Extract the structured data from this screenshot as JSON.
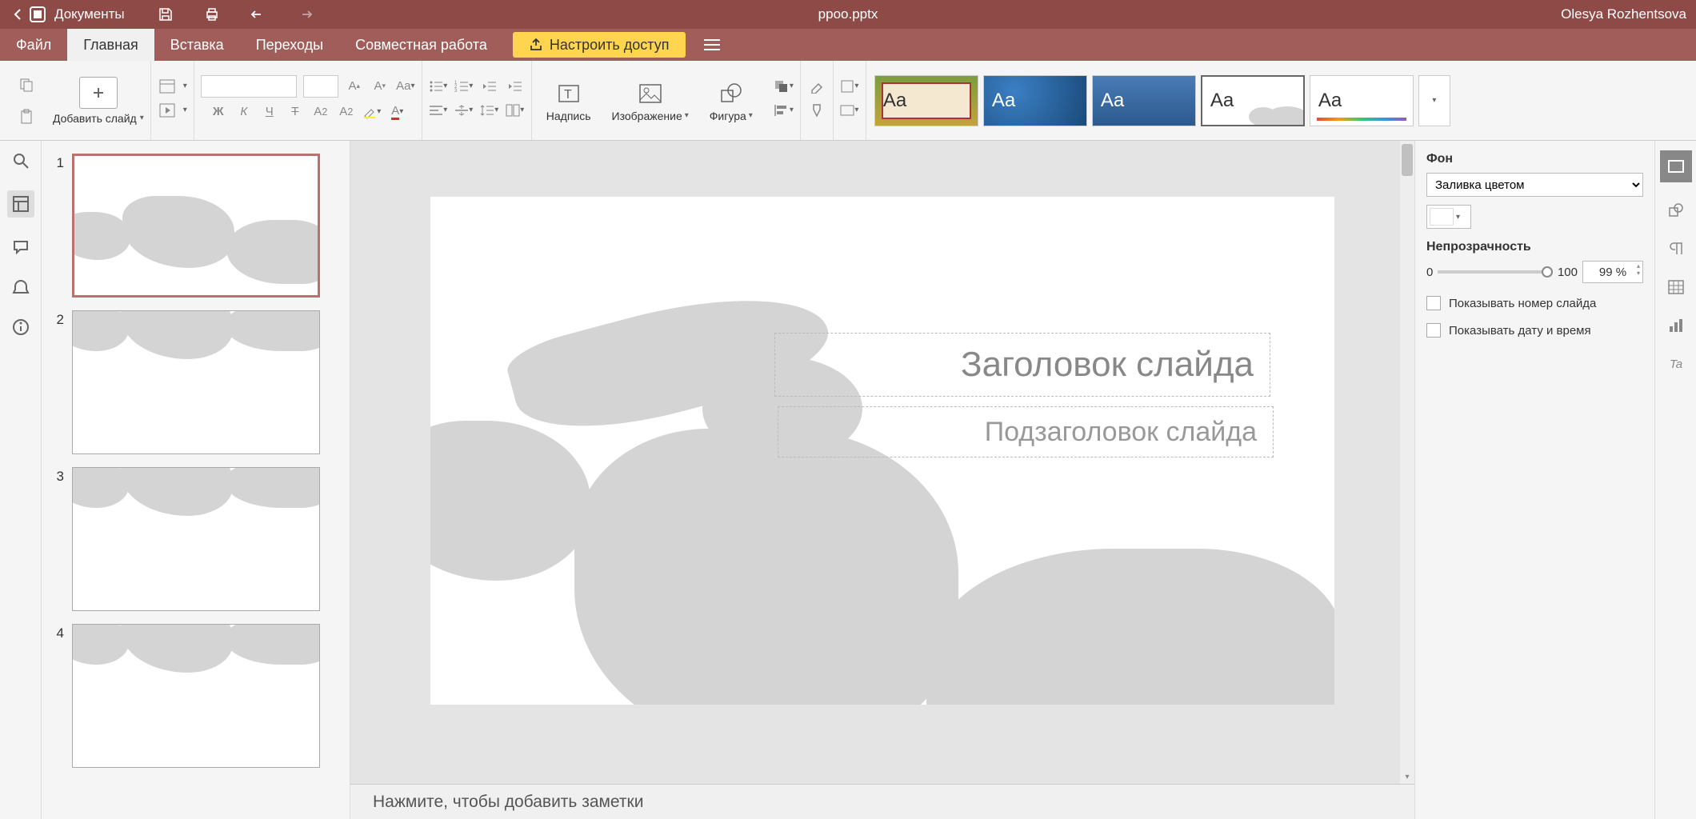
{
  "titlebar": {
    "app_label": "Документы",
    "file_name": "ppoo.pptx",
    "user_name": "Olesya Rozhentsova"
  },
  "menu": {
    "file": "Файл",
    "home": "Главная",
    "insert": "Вставка",
    "transitions": "Переходы",
    "collab": "Совместная работа",
    "share": "Настроить доступ"
  },
  "toolbar": {
    "add_slide": "Добавить слайд",
    "text_box": "Надпись",
    "image": "Изображение",
    "shape": "Фигура"
  },
  "slides": {
    "n1": "1",
    "n2": "2",
    "n3": "3",
    "n4": "4"
  },
  "canvas": {
    "title_placeholder": "Заголовок слайда",
    "subtitle_placeholder": "Подзаголовок слайда",
    "notes_placeholder": "Нажмите, чтобы добавить заметки"
  },
  "right_panel": {
    "background_label": "Фон",
    "fill_type": "Заливка цветом",
    "opacity_label": "Непрозрачность",
    "opacity_min": "0",
    "opacity_max": "100",
    "opacity_value": "99 %",
    "show_slide_number": "Показывать номер слайда",
    "show_date_time": "Показывать дату и время"
  }
}
